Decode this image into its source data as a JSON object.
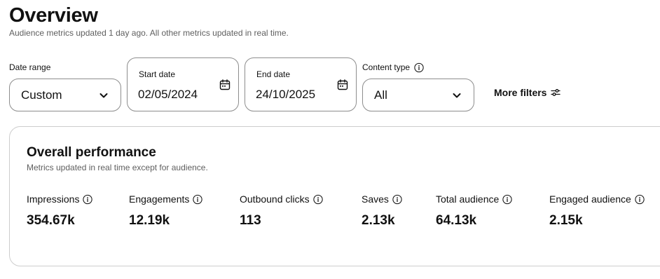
{
  "header": {
    "title": "Overview",
    "subtitle": "Audience metrics updated 1 day ago. All other metrics updated in real time."
  },
  "filters": {
    "date_range": {
      "label": "Date range",
      "value": "Custom"
    },
    "start_date": {
      "label": "Start date",
      "value": "02/05/2024"
    },
    "end_date": {
      "label": "End date",
      "value": "24/10/2025"
    },
    "content_type": {
      "label": "Content type",
      "value": "All"
    },
    "more_filters_label": "More filters"
  },
  "performance": {
    "title": "Overall performance",
    "subtitle": "Metrics updated in real time except for audience.",
    "metrics": [
      {
        "label": "Impressions",
        "value": "354.67k"
      },
      {
        "label": "Engagements",
        "value": "12.19k"
      },
      {
        "label": "Outbound clicks",
        "value": "113"
      },
      {
        "label": "Saves",
        "value": "2.13k"
      },
      {
        "label": "Total audience",
        "value": "64.13k"
      },
      {
        "label": "Engaged audience",
        "value": "2.15k"
      }
    ]
  },
  "icons": {
    "info": "info-icon",
    "calendar": "calendar-icon",
    "chevron": "chevron-down-icon",
    "sliders": "sliders-icon"
  },
  "colors": {
    "text": "#111111",
    "muted_text": "#5f5f5f",
    "border": "#8d8d8d",
    "card_border": "#cdcdcd"
  }
}
